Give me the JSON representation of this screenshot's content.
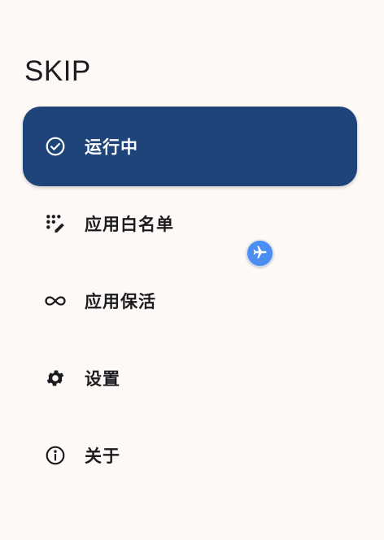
{
  "app": {
    "title": "SKIP"
  },
  "nav": {
    "items": [
      {
        "label": "运行中",
        "icon": "check-circle-icon",
        "active": true
      },
      {
        "label": "应用白名单",
        "icon": "edit-grid-icon",
        "active": false
      },
      {
        "label": "应用保活",
        "icon": "infinity-icon",
        "active": false
      },
      {
        "label": "设置",
        "icon": "gear-icon",
        "active": false
      },
      {
        "label": "关于",
        "icon": "info-icon",
        "active": false
      }
    ]
  },
  "floating_button": {
    "icon": "airplane-icon"
  },
  "colors": {
    "background": "#fdf9f6",
    "active_item": "#1f447a",
    "active_text": "#ffffff",
    "text": "#1c1b1f",
    "fab": "#4b8ef1"
  }
}
